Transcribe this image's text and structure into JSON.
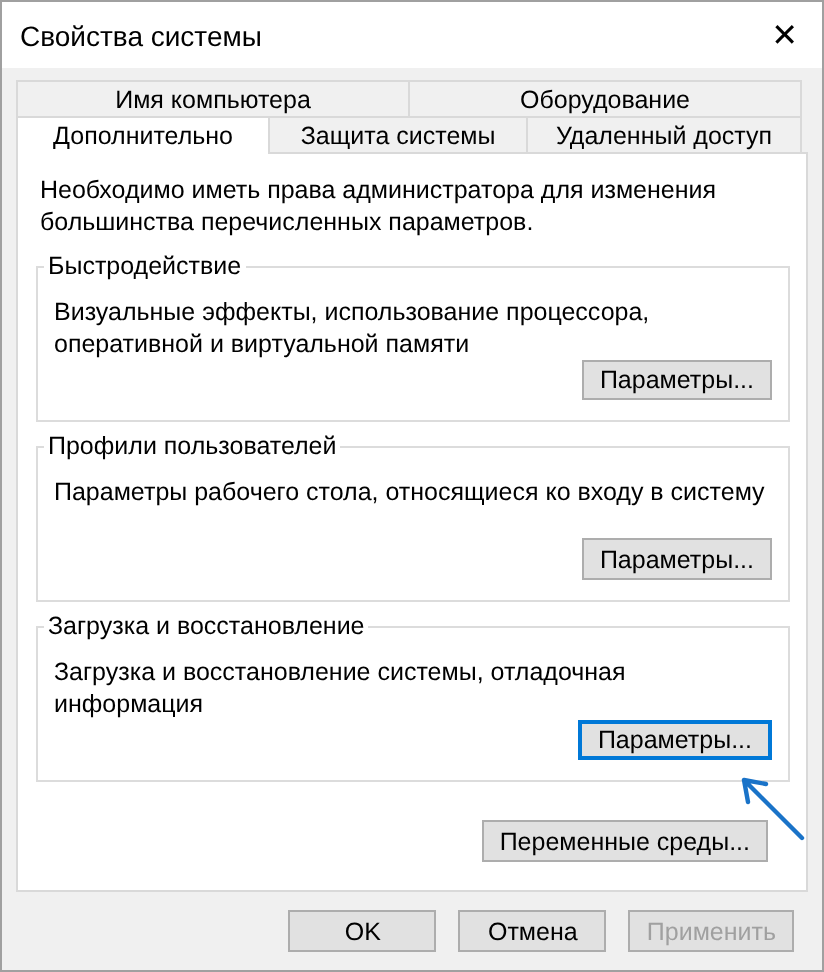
{
  "window": {
    "title": "Свойства системы",
    "close": "✕"
  },
  "tab_rows": [
    [
      {
        "label": "Имя компьютера",
        "selected": false
      },
      {
        "label": "Оборудование",
        "selected": false
      }
    ],
    [
      {
        "label": "Дополнительно",
        "selected": true
      },
      {
        "label": "Защита системы",
        "selected": false
      },
      {
        "label": "Удаленный доступ",
        "selected": false
      }
    ]
  ],
  "notice": "Необходимо иметь права администратора для изменения большинства перечисленных параметров.",
  "groups": [
    {
      "title": "Быстродействие",
      "description": "Визуальные эффекты, использование процессора, оперативной и виртуальной памяти",
      "button": "Параметры...",
      "focused": false
    },
    {
      "title": "Профили пользователей",
      "description": "Параметры рабочего стола, относящиеся ко входу в систему",
      "button": "Параметры...",
      "focused": false
    },
    {
      "title": "Загрузка и восстановление",
      "description": "Загрузка и восстановление системы, отладочная информация",
      "button": "Параметры...",
      "focused": true
    }
  ],
  "env_button": "Переменные среды...",
  "footer_buttons": [
    {
      "label": "OK",
      "disabled": false
    },
    {
      "label": "Отмена",
      "disabled": false
    },
    {
      "label": "Применить",
      "disabled": true
    }
  ]
}
